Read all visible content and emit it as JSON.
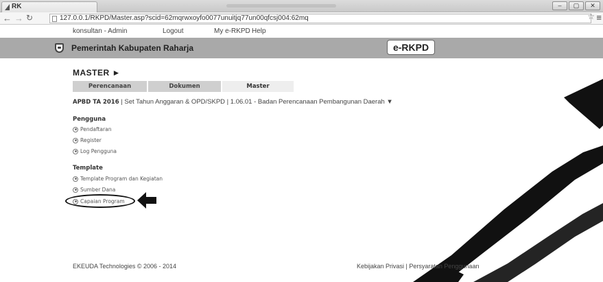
{
  "browser": {
    "tab_title": "RK",
    "url": "127.0.0.1/RKPD/Master.asp?scid=62mqrwxoyfo0077unuitjq77un00qfcsj004:62mq",
    "window_controls": [
      "–",
      "▢",
      "✕"
    ]
  },
  "toplinks": {
    "user": "konsultan - Admin",
    "logout": "Logout",
    "my_erkpd": "My e-RKPD",
    "help": "Help"
  },
  "header": {
    "title": "Pemerintah Kabupaten Raharja",
    "brand": "e-RKPD"
  },
  "main": {
    "title": "MASTER ►",
    "tabs": [
      {
        "label": "Perencanaan"
      },
      {
        "label": "Dokumen"
      },
      {
        "label": "Master"
      }
    ],
    "context": {
      "year": "APBD TA 2016",
      "text": " | Set Tahun Anggaran & OPD/SKPD | 1.06.01 - Badan Perencanaan Pembangunan Daerah ▼"
    },
    "sections": [
      {
        "title": "Pengguna",
        "items": [
          {
            "label": "Pendaftaran"
          },
          {
            "label": "Register"
          },
          {
            "label": "Log Pengguna"
          }
        ]
      },
      {
        "title": "Template",
        "items": [
          {
            "label": "Template Program dan Kegiatan"
          },
          {
            "label": "Sumber Dana"
          },
          {
            "label": "Capaian Program"
          }
        ]
      }
    ]
  },
  "footer": {
    "copyright": "EKEUDA Technologies © 2006 - 2014",
    "links": "Kebijakan Privasi | Persyaratan Penggunaan"
  },
  "icons": {
    "back": "back-arrow-icon",
    "forward": "forward-arrow-icon",
    "reload": "reload-icon",
    "bookmark": "star-icon",
    "menu": "hamburger-menu-icon",
    "bullet": "circle-bullet-icon"
  },
  "colors": {
    "header_band": "#a9a9a9",
    "tab_inactive": "#cfcfcf",
    "tab_active": "#eeeeee"
  }
}
